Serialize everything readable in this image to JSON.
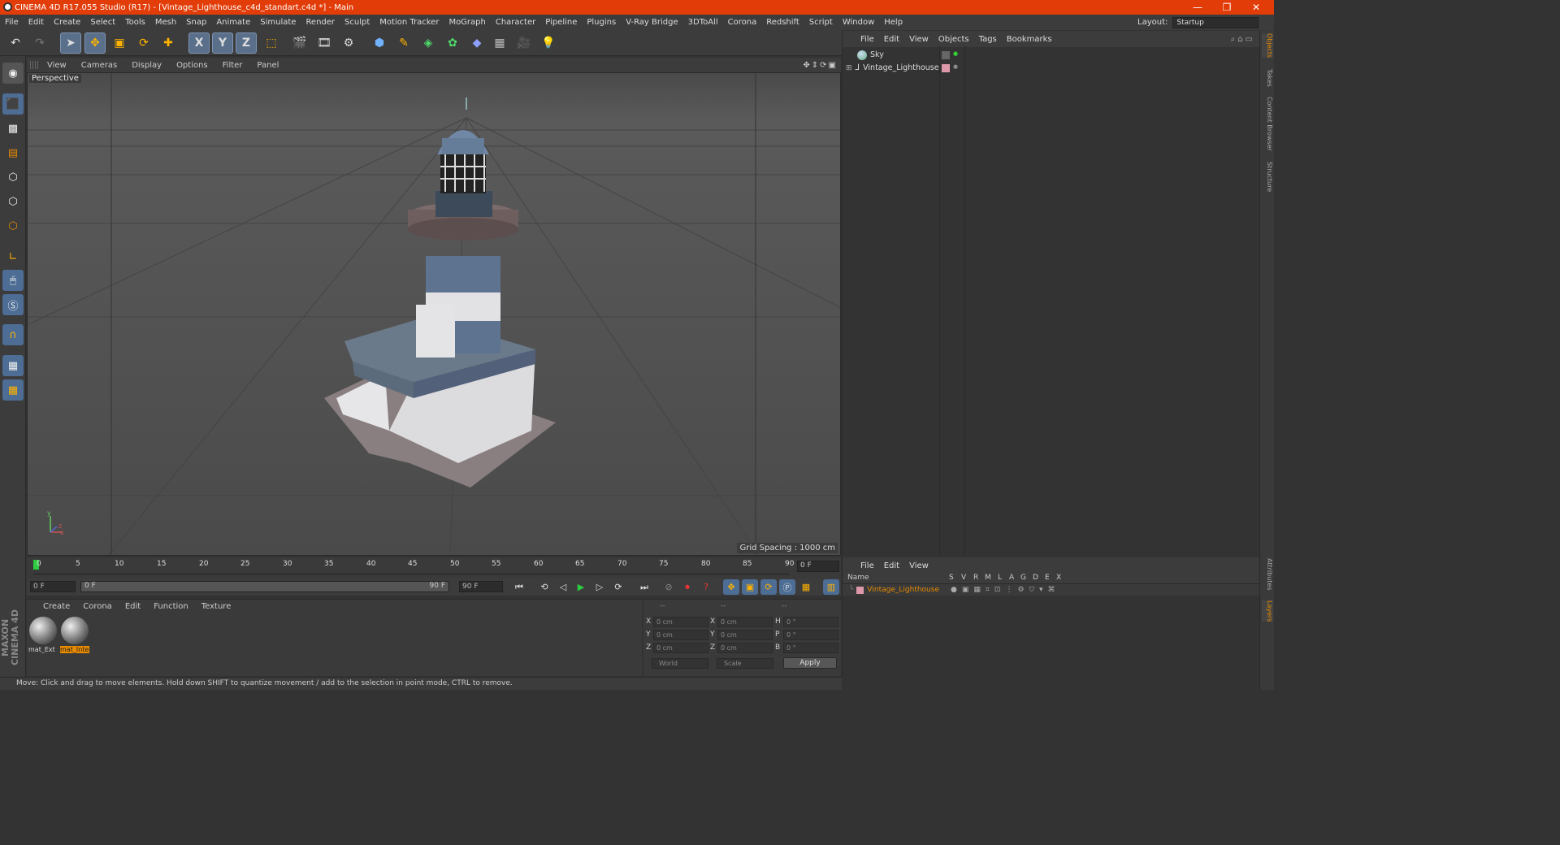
{
  "window": {
    "title": "CINEMA 4D R17.055 Studio (R17) - [Vintage_Lighthouse_c4d_standart.c4d *] - Main",
    "minimize": "—",
    "restore": "❐",
    "close": "✕"
  },
  "menubar": [
    "File",
    "Edit",
    "Create",
    "Select",
    "Tools",
    "Mesh",
    "Snap",
    "Animate",
    "Simulate",
    "Render",
    "Sculpt",
    "Motion Tracker",
    "MoGraph",
    "Character",
    "Pipeline",
    "Plugins",
    "V-Ray Bridge",
    "3DToAll",
    "Corona",
    "Redshift",
    "Script",
    "Window",
    "Help"
  ],
  "layout": {
    "label": "Layout:",
    "value": "Startup"
  },
  "toolbar": {
    "axis_x": "X",
    "axis_y": "Y",
    "axis_z": "Z"
  },
  "viewport": {
    "menu": [
      "View",
      "Cameras",
      "Display",
      "Options",
      "Filter",
      "Panel"
    ],
    "label": "Perspective",
    "grid_spacing": "Grid Spacing : 1000 cm",
    "axis_y": "y",
    "axis_z": "z",
    "axis_x": "x"
  },
  "timeline": {
    "ticks": [
      "0",
      "5",
      "10",
      "15",
      "20",
      "25",
      "30",
      "35",
      "40",
      "45",
      "50",
      "55",
      "60",
      "65",
      "70",
      "75",
      "80",
      "85",
      "90"
    ],
    "current_frame": "0 F",
    "start_field": "0 F",
    "range_start": "0 F",
    "range_end": "90 F",
    "end_field": "90 F"
  },
  "material_manager": {
    "menu": [
      "Create",
      "Corona",
      "Edit",
      "Function",
      "Texture"
    ],
    "materials": [
      {
        "label": "mat_Ext",
        "selected": false
      },
      {
        "label": "mat_Inte",
        "selected": true
      }
    ]
  },
  "coordinates": {
    "header": [
      "--",
      "--",
      "--"
    ],
    "rows": [
      {
        "axis": "X",
        "pos": "0 cm",
        "axis2": "X",
        "size": "0 cm",
        "rlabel": "H",
        "rot": "0 °"
      },
      {
        "axis": "Y",
        "pos": "0 cm",
        "axis2": "Y",
        "size": "0 cm",
        "rlabel": "P",
        "rot": "0 °"
      },
      {
        "axis": "Z",
        "pos": "0 cm",
        "axis2": "Z",
        "size": "0 cm",
        "rlabel": "B",
        "rot": "0 °"
      }
    ],
    "world": "World",
    "scale": "Scale",
    "apply": "Apply"
  },
  "status": "Move: Click and drag to move elements. Hold down SHIFT to quantize movement / add to the selection in point mode, CTRL to remove.",
  "logo": "MAXON CINEMA 4D",
  "object_manager": {
    "menu": [
      "File",
      "Edit",
      "View",
      "Objects",
      "Tags",
      "Bookmarks"
    ],
    "objects": [
      {
        "name": "Sky"
      },
      {
        "name": "Vintage_Lighthouse"
      }
    ]
  },
  "layer_manager": {
    "menu": [
      "File",
      "Edit",
      "View"
    ],
    "columns": [
      "Name",
      "S",
      "V",
      "R",
      "M",
      "L",
      "A",
      "G",
      "D",
      "E",
      "X"
    ],
    "layers": [
      {
        "name": "Vintage_Lighthouse",
        "color": "#e88a00"
      }
    ]
  },
  "side_tabs": [
    "Objects",
    "Takes",
    "Content Browser",
    "Structure",
    "Attributes",
    "Layers"
  ],
  "colors": {
    "accent": "#e23c08",
    "selection": "#e88a00",
    "active_tool": "#5a6f8a"
  }
}
